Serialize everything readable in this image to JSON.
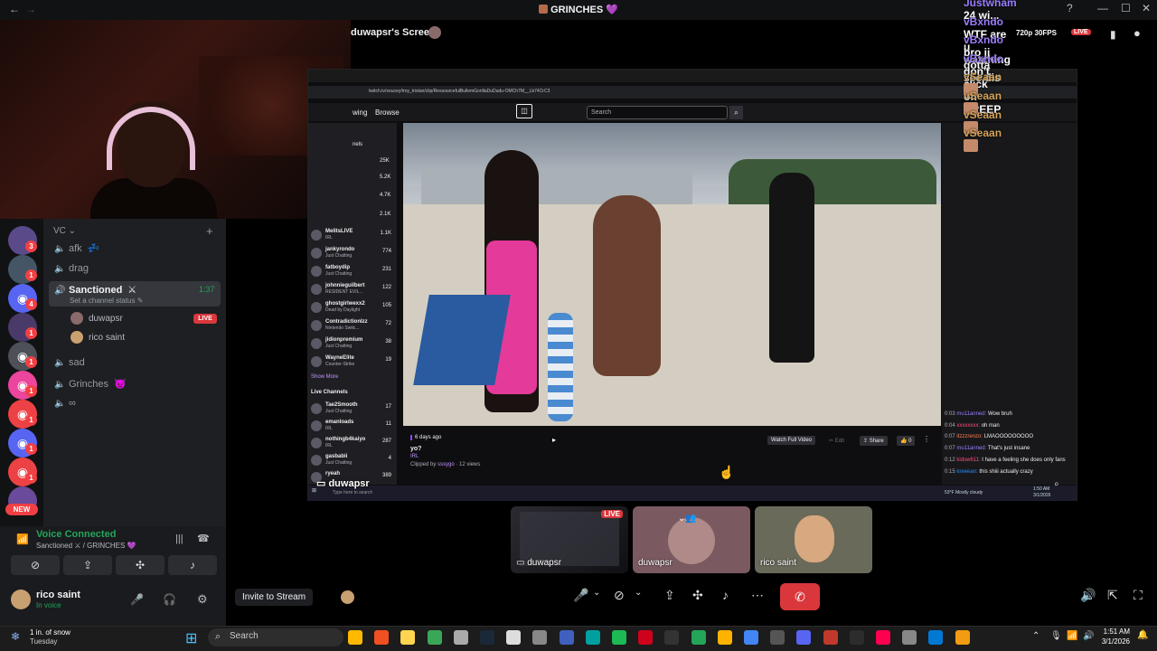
{
  "window": {
    "title": "GRINCHES",
    "title_emoji": "💜"
  },
  "webcam": {},
  "servers": {
    "badges": [
      "3",
      "1",
      "4",
      "1",
      "1",
      "1",
      "1",
      "1",
      "1"
    ],
    "new_label": "NEW"
  },
  "channels": {
    "category": "VC",
    "items": [
      {
        "name": "afk",
        "emoji": "💤"
      },
      {
        "name": "drag",
        "emoji": ""
      },
      {
        "name": "Sanctioned",
        "emoji": "⚔",
        "timer": "1:37",
        "status": "Set a channel status"
      },
      {
        "name": "sad",
        "emoji": ""
      },
      {
        "name": "Grinches",
        "emoji": "😈"
      },
      {
        "name": "∞",
        "emoji": ""
      }
    ],
    "members": [
      {
        "name": "duwapsr",
        "badge": "LIVE"
      },
      {
        "name": "rico saint",
        "badge": ""
      }
    ]
  },
  "voice": {
    "status": "Voice Connected",
    "location": "Sanctioned ⚔ / GRINCHES 💜",
    "user_name": "rico saint",
    "user_status": "In voice"
  },
  "stream": {
    "screen_label": "duwapsr's Screen",
    "invite": "Invite to Stream",
    "browser_url": "twitch.tv/soucey/troy_tristan/clip/RessourcefulBullemGorillaDuDudu-OMCh7M__Lb74CrC3",
    "browse": "Browse",
    "search_placeholder": "Search",
    "clip_age": "6 days ago",
    "clip_title": "yo?",
    "clip_cat": "IRL",
    "clip_by": "Clipped by ",
    "clip_user": "sssygo",
    "clip_views": " · 12 views",
    "watch_full": "Watch Full Video",
    "edit": "Edit",
    "share": "Share",
    "likes": "0",
    "show_more": "Show More",
    "live_channels": "Live Channels",
    "follow_list": [
      {
        "name": "MelitsLIVE",
        "sub": "IRL",
        "count": "1.1K"
      },
      {
        "name": "jankyrondo",
        "sub": "Just Chatting",
        "count": "774"
      },
      {
        "name": "fatboydip",
        "sub": "Just Chatting",
        "count": "231"
      },
      {
        "name": "johnnieguilbert",
        "sub": "RESIDENT EVIL...",
        "count": "122"
      },
      {
        "name": "ghostgirlwexx2",
        "sub": "Dead by Daylight",
        "count": "105"
      },
      {
        "name": "ContradictionIzz",
        "sub": "Nintendo Switc...",
        "count": "72"
      },
      {
        "name": "jidionpremium",
        "sub": "Just Chatting",
        "count": "38"
      },
      {
        "name": "WayneElite",
        "sub": "Counter-Strike",
        "count": "19"
      }
    ],
    "top_counts": [
      "25K",
      "5.2K",
      "4.7K",
      "2.1K"
    ],
    "live_list": [
      {
        "name": "Tae2Smooth",
        "sub": "Just Chatting",
        "count": "17"
      },
      {
        "name": "emanloads",
        "sub": "IRL",
        "count": "11"
      },
      {
        "name": "nothingb4kaiyo",
        "sub": "IRL",
        "count": "287"
      },
      {
        "name": "gasbabii",
        "sub": "Just Chatting",
        "count": "4"
      },
      {
        "name": "ryeah",
        "sub": "",
        "count": "389"
      }
    ],
    "twitch_chat": [
      {
        "time": "0:03",
        "user": "mu11anned:",
        "msg": "Wow bruh"
      },
      {
        "time": "0:04",
        "user": "xxxxxxxx:",
        "msg": "oh man"
      },
      {
        "time": "0:07",
        "user": "itzzzrenzo:",
        "msg": "LMAOOOOOOOOO"
      },
      {
        "time": "0:07",
        "user": "mu11anned:",
        "msg": "That's just insane"
      },
      {
        "time": "0:12",
        "user": "kidsw611:",
        "msg": "I have a feeling she does only fans"
      },
      {
        "time": "0:15",
        "user": "kreeean:",
        "msg": "this shiii actually crazy"
      }
    ],
    "sharer_label": "duwapsr",
    "inner_taskbar_search": "Type here to search",
    "inner_weather": "53°F  Mostly cloudy",
    "inner_time": "1:50 AM",
    "inner_date": "3/1/2026"
  },
  "overlay_chat": [
    {
      "user": "Justwham",
      "msg": "24 wi..."
    },
    {
      "user": "vBxndo",
      "msg": "WTF are u watching"
    },
    {
      "user": "vBxndo",
      "msg": "bro jj gotta see dis"
    },
    {
      "user": "vBxndo",
      "msg": "don't click off CREEP"
    },
    {
      "user": "vSeaan",
      "msg": ""
    },
    {
      "user": "vSeaan",
      "msg": ""
    },
    {
      "user": "vSeaan",
      "msg": ""
    },
    {
      "user": "vSeaan",
      "msg": ""
    }
  ],
  "overlay_stats": "720p 30FPS",
  "overlay_live": "LIVE",
  "tiles": [
    {
      "name": "duwapsr",
      "badge": "LIVE"
    },
    {
      "name": "duwapsr",
      "badge": ""
    },
    {
      "name": "rico saint",
      "badge": ""
    }
  ],
  "taskbar": {
    "weather_line1": "1 in. of snow",
    "weather_line2": "Tuesday",
    "search": "Search",
    "time": "1:51 AM",
    "date": "3/1/2026"
  },
  "colors": {
    "discord_green": "#23a55a",
    "live_red": "#da373c",
    "twitch_purple": "#9147ff",
    "blurple": "#5865f2"
  }
}
